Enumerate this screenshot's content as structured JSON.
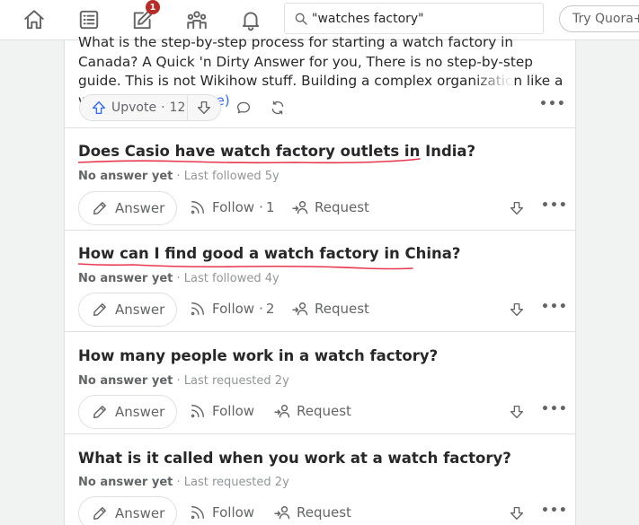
{
  "search": {
    "value": "\"watches factory\""
  },
  "header": {
    "notification_badge": "1",
    "try_button": "Try Quora+"
  },
  "answer_excerpt": {
    "text": "What is the step-by-step process for starting a watch factory in Canada? A Quick 'n Dirty Answer for you, There is no step-by-step guide. This is not Wikihow stuff. Building a complex organization like a watch compan",
    "more": "(more)",
    "upvote_label": "Upvote",
    "upvote_count": "12"
  },
  "questions": [
    {
      "title": "Does Casio have watch factory outlets in India?",
      "status": "No answer yet",
      "activity": "Last followed 5y",
      "answer_label": "Answer",
      "follow_label": "Follow",
      "follow_count": "1",
      "request_label": "Request"
    },
    {
      "title": "How can I find good a watch factory in China?",
      "status": "No answer yet",
      "activity": "Last followed 4y",
      "answer_label": "Answer",
      "follow_label": "Follow",
      "follow_count": "2",
      "request_label": "Request"
    },
    {
      "title": "How many people work in a watch factory?",
      "status": "No answer yet",
      "activity": "Last requested 2y",
      "answer_label": "Answer",
      "follow_label": "Follow",
      "follow_count": "",
      "request_label": "Request"
    },
    {
      "title": "What is it called when you work at a watch factory?",
      "status": "No answer yet",
      "activity": "Last requested 2y",
      "answer_label": "Answer",
      "follow_label": "Follow",
      "follow_count": "",
      "request_label": "Request"
    }
  ],
  "colors": {
    "accent": "#2e69ff",
    "badge": "#b92b27",
    "annotation": "#e8384f"
  }
}
